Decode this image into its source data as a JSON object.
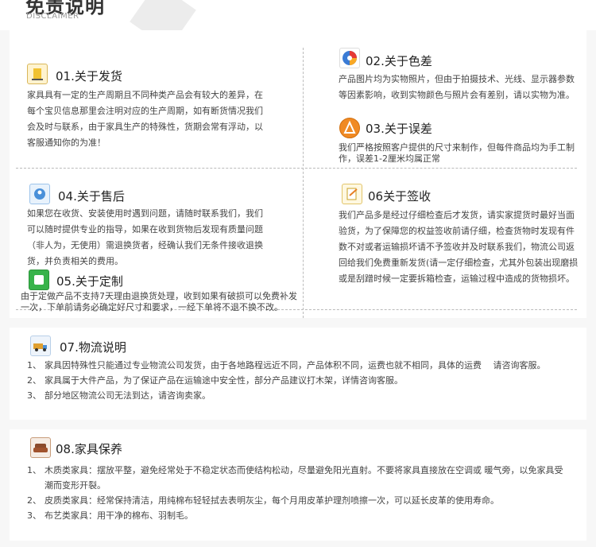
{
  "header": {
    "title": "免责说明",
    "subtitle": "DISCLAIMER"
  },
  "sections": [
    {
      "id": "s1",
      "heading": "01.关于发货",
      "icon": "shipping-icon",
      "text": "家具具有一定的生产周期且不同种类产品会有较大的差异，在每个宝贝信息那里会注明对应的生产周期，如有断货情况我们会及时与联系，由于家具生产的特殊性，货期会常有浮动，以客服通知你的为准！"
    },
    {
      "id": "s2",
      "heading": "02.关于色差",
      "icon": "color-wheel-icon",
      "text": "产品图片均为实物照片，但由于拍摄技术、光线、显示器参数等因素影响，收到实物颜色与照片会有差别，请以实物为准。"
    },
    {
      "id": "s3",
      "heading": "03.关于误差",
      "icon": "ruler-icon",
      "text": "我们严格按照客户提供的尺寸来制作，但每件商品均为手工制作，误差1-2厘米均属正常"
    },
    {
      "id": "s4",
      "heading": "04.关于售后",
      "icon": "service-icon",
      "text": "如果您在收货、安装使用时遇到问题，请随时联系我们，我们可以随时提供专业的指导，如果在收到货物后发现有质量问题（非人为，无使用）需退换货者，经确认我们无条件接收退换货，并负责相关的费用。"
    },
    {
      "id": "s5",
      "heading": "05.关于定制",
      "icon": "custom-icon",
      "text": "由于定做产品不支持7天理由退换货处理，收到如果有破损可以免费补发一次，下单前请务必确定好尺寸和要求，一经下单将不退不换不改。"
    },
    {
      "id": "s6",
      "heading": "06关于签收",
      "icon": "sign-icon",
      "text": "我们产品多是经过仔细检查后才发货，请实家提货时最好当面验货，为了保障您的权益签收前请仔细，检查货物时发现有件数不对或者运输损坏请不予签收并及时联系我们，物流公司返回给我们免费重新发货(请一定仔细检查，尤其外包装出现磨损或是刮蹭时候一定要拆箱检查，运输过程中造成的货物损坏。"
    }
  ],
  "logistics": {
    "heading": "07.物流说明",
    "icon": "truck-icon",
    "items": [
      {
        "num": "1、",
        "text": "家具因特殊性只能通过专业物流公司发货，由于各地路程远近不同，产品体积不同，运费也就不相同，具体的运费　 请咨询客服。"
      },
      {
        "num": "2、",
        "text": "家具属于大件产品，为了保证产品在运输途中安全性，部分产品建议打木架，详情咨询客服。"
      },
      {
        "num": "3、",
        "text": "部分地区物流公司无法到达，请咨询卖家。"
      }
    ]
  },
  "care": {
    "heading": "08.家具保养",
    "icon": "sofa-icon",
    "items": [
      {
        "num": "1、",
        "text": "木质类家具：摆放平整，避免经常处于不稳定状态而使结构松动，尽量避免阳光直射。不要将家具直接放在空调或 暖气旁，以免家具受潮而变形开裂。"
      },
      {
        "num": "2、",
        "text": "皮质类家具：经常保持清洁，用纯棉布轻轻拭去表明灰尘，每个月用皮革护理剂喷擦一次，可以延长皮革的使用寿命。"
      },
      {
        "num": "3、",
        "text": "布艺类家具：用干净的棉布、羽制毛。"
      }
    ]
  }
}
